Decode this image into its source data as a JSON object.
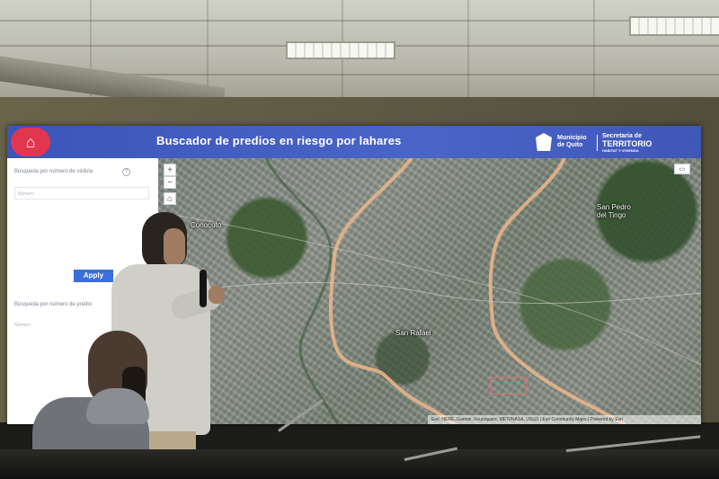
{
  "app": {
    "title": "Buscador de predios en riesgo por lahares",
    "logo_icon": "location-pin-icon",
    "municipality": "Municipio\nde Quito",
    "secretaria_line1": "Secretaría de",
    "secretaria_line2": "TERRITORIO",
    "secretaria_line3": "HÁBITAT Y VIVIENDA",
    "header_color": "#4a64c8",
    "logo_color": "#e2364f",
    "button_color": "#3b6fd9"
  },
  "panel": {
    "search_by_id_label": "Búsqueda por número de cédula",
    "id_input_placeholder": "Número",
    "apply_label": "Apply",
    "search_by_property_label": "Búsqueda por número de predio",
    "property_input_placeholder": "Número"
  },
  "map": {
    "places": {
      "conocoto": "Conocoto",
      "san_rafael": "San Rafael",
      "san_pedro": "San Pedro\ndel Tingo"
    },
    "zoom_in": "+",
    "zoom_out": "−",
    "home": "⌂",
    "layer_toggle": "▭",
    "attribution": "Esri, HERE, Garmin, Foursquare, METI/NASA, USGS | Esri Community Maps | Powered by Esri"
  }
}
